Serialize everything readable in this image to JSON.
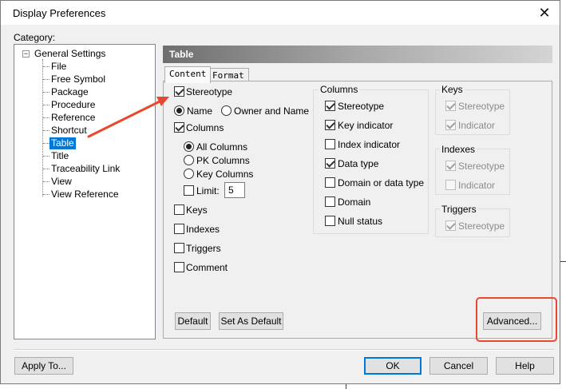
{
  "window": {
    "title": "Display Preferences",
    "close_glyph": "✕"
  },
  "category": {
    "label": "Category:"
  },
  "tree": {
    "root": {
      "label": "General Settings",
      "expander": "−"
    },
    "items": [
      {
        "label": "File"
      },
      {
        "label": "Free Symbol"
      },
      {
        "label": "Package"
      },
      {
        "label": "Procedure"
      },
      {
        "label": "Reference"
      },
      {
        "label": "Shortcut"
      },
      {
        "label": "Table",
        "selected": true
      },
      {
        "label": "Title"
      },
      {
        "label": "Traceability Link"
      },
      {
        "label": "View"
      },
      {
        "label": "View Reference"
      }
    ]
  },
  "pane": {
    "title": "Table",
    "tabs": [
      {
        "label": "Content",
        "active": true
      },
      {
        "label": "Format"
      }
    ]
  },
  "content": {
    "stereotype": {
      "label": "Stereotype",
      "checked": true
    },
    "name_radio": {
      "label": "Name",
      "checked": true
    },
    "owner_radio": {
      "label": "Owner and Name",
      "checked": false
    },
    "columns": {
      "label": "Columns",
      "checked": true
    },
    "all_columns": {
      "label": "All Columns",
      "checked": true
    },
    "pk_columns": {
      "label": "PK Columns",
      "checked": false
    },
    "key_columns": {
      "label": "Key Columns",
      "checked": false
    },
    "limit": {
      "label": "Limit:",
      "checked": false,
      "value": "5"
    },
    "keys": {
      "label": "Keys",
      "checked": false
    },
    "indexes": {
      "label": "Indexes",
      "checked": false
    },
    "triggers": {
      "label": "Triggers",
      "checked": false
    },
    "comment": {
      "label": "Comment",
      "checked": false
    }
  },
  "columns_group": {
    "title": "Columns",
    "items": [
      {
        "label": "Stereotype",
        "checked": true
      },
      {
        "label": "Key indicator",
        "checked": true
      },
      {
        "label": "Index indicator",
        "checked": false
      },
      {
        "label": "Data type",
        "checked": true
      },
      {
        "label": "Domain or data type",
        "checked": false
      },
      {
        "label": "Domain",
        "checked": false
      },
      {
        "label": "Null status",
        "checked": false
      }
    ]
  },
  "keys_group": {
    "title": "Keys",
    "items": [
      {
        "label": "Stereotype",
        "checked": true
      },
      {
        "label": "Indicator",
        "checked": true
      }
    ]
  },
  "indexes_group": {
    "title": "Indexes",
    "items": [
      {
        "label": "Stereotype",
        "checked": true
      },
      {
        "label": "Indicator",
        "checked": false
      }
    ]
  },
  "triggers_group": {
    "title": "Triggers",
    "items": [
      {
        "label": "Stereotype",
        "checked": true
      }
    ]
  },
  "buttons": {
    "default": "Default",
    "set_as_default": "Set As Default",
    "advanced": "Advanced...",
    "apply_to": "Apply To...",
    "ok": "OK",
    "cancel": "Cancel",
    "help": "Help"
  },
  "annotation": {
    "arrow_color": "#e8482f",
    "box_color": "#e8482f"
  },
  "colors": {
    "selection": "#0078d7",
    "default_button_border": "#0078d7"
  }
}
